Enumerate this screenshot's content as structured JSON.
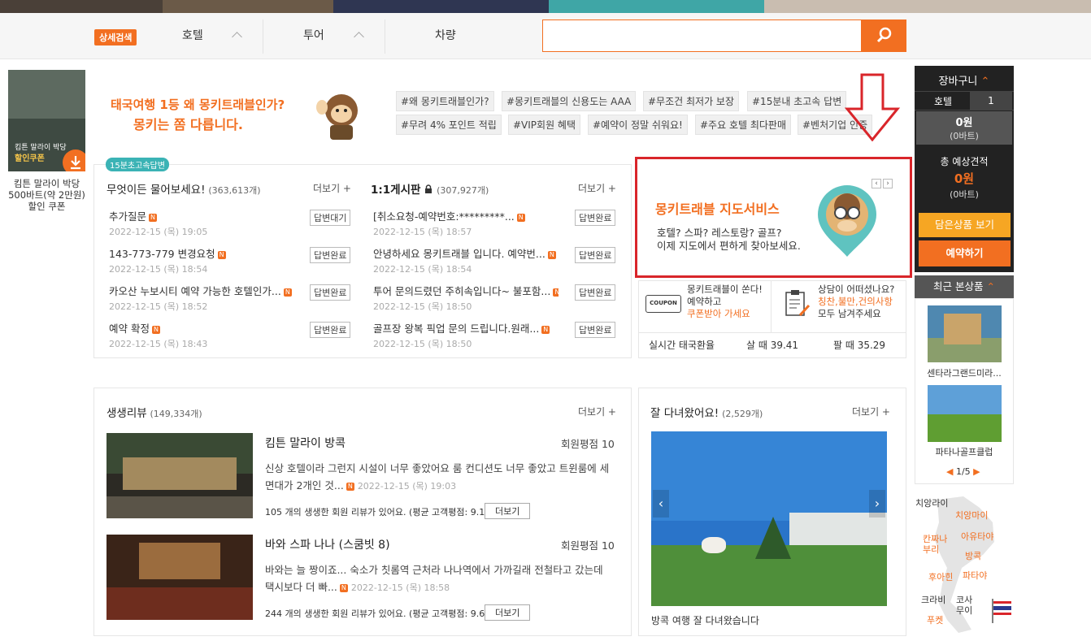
{
  "nav": {
    "badge": "상세검색",
    "tabs": [
      "호텔",
      "투어",
      "차량"
    ],
    "search_placeholder": ""
  },
  "promo": {
    "thumb_line1": "킴튼 말라이 박당",
    "thumb_line2": "할인쿠폰",
    "caption1": "킴튼 말라이 박당",
    "caption2": "500바트(약 2만원)",
    "caption3": "할인 쿠폰",
    "headline1": "태국여행 1등 왜 몽키트래블인가?",
    "headline2": "몽키는 쫌 다릅니다.",
    "tags": [
      "#왜 몽키트래블인가?",
      "#몽키트래블의 신용도는 AAA",
      "#무조건 최저가 보장",
      "#15분내 초고속 답변",
      "#무려 4% 포인트 적립",
      "#VIP회원 혜택",
      "#예약이 정말 쉬워요!",
      "#주요 호텔 최다판매",
      "#벤처기업 인증"
    ]
  },
  "qa": {
    "fast_badge": "15분초고속답변",
    "left_title": "무엇이든 물어보세요!",
    "left_count": "(363,613개)",
    "right_title": "1:1게시판",
    "right_count": "(307,927개)",
    "more": "더보기 +",
    "left_items": [
      {
        "q": "추가질문",
        "date": "2022-12-15 (목) 19:05",
        "status": "답변대기"
      },
      {
        "q": "143-773-779 변경요청",
        "date": "2022-12-15 (목) 18:54",
        "status": "답변완료"
      },
      {
        "q": "카오산 누보시티 예약 가능한 호텔인가...",
        "date": "2022-12-15 (목) 18:52",
        "status": "답변완료"
      },
      {
        "q": "예약 확정",
        "date": "2022-12-15 (목) 18:43",
        "status": "답변완료"
      }
    ],
    "right_items": [
      {
        "q": "[취소요청-예약번호:*********...",
        "date": "2022-12-15 (목) 18:57",
        "status": "답변완료"
      },
      {
        "q": "안녕하세요 몽키트래블 입니다. 예약번...",
        "date": "2022-12-15 (목) 18:54",
        "status": "답변완료"
      },
      {
        "q": "투어 문의드렸던 주히속입니다~ 불포함...",
        "date": "2022-12-15 (목) 18:50",
        "status": "답변완료"
      },
      {
        "q": "골프장 왕복 픽업 문의 드립니다.원래...",
        "date": "2022-12-15 (목) 18:50",
        "status": "답변완료"
      }
    ],
    "new_mark": "N"
  },
  "map_service": {
    "title": "몽키트래블 지도서비스",
    "line1": "호텔? 스파? 레스토랑? 골프?",
    "line2": "이제 지도에서 편하게 찾아보세요."
  },
  "coupon": {
    "icon_text": "COUPON",
    "line1": "몽키트래블이 쏜다!",
    "line2": "예약하고",
    "line3": "쿠폰받아 가세요"
  },
  "consult": {
    "line1": "상담이 어떠셨나요?",
    "line2": "칭찬,불만,건의사항",
    "line3": "모두 남겨주세요"
  },
  "rate": {
    "label": "실시간 태국환율",
    "buy": "살 때 39.41",
    "sell": "팔 때 35.29"
  },
  "reviews": {
    "title": "생생리뷰",
    "count": "(149,334개)",
    "more": "더보기 +",
    "items": [
      {
        "title": "킴튼 말라이 방콕",
        "score": "회원평점 10",
        "body1": "신상 호텔이라 그런지 시설이 너무 좋았어요 룸 컨디션도 너무 좋았고 트윈룸에 세",
        "body2": "면대가 2개인 것...",
        "date": "2022-12-15 (목) 19:03",
        "foot": "105 개의 생생한 회원 리뷰가 있어요. (평균 고객평점: 9.1)",
        "btn": "더보기"
      },
      {
        "title": "바와 스파 나나 (스쿰빗 8)",
        "score": "회원평점 10",
        "body1": "바와는 늘 짱이죠... 숙소가 칫롬역 근처라 나나역에서 가까길래 전철타고 갔는데",
        "body2": "택시보다 더 빠...",
        "date": "2022-12-15 (목) 18:58",
        "foot": "244 개의 생생한 회원 리뷰가 있어요. (평균 고객평점: 9.6)",
        "btn": "더보기"
      }
    ]
  },
  "visited": {
    "title": "잘 다녀왔어요!",
    "count": "(2,529개)",
    "more": "더보기 +",
    "caption": "방콕 여행 잘 다녀왔습니다"
  },
  "cart": {
    "title": "장바구니",
    "hotel_label": "호텔",
    "hotel_count": "1",
    "amount": "0원",
    "amount_baht": "(0바트)",
    "total_label": "총 예상견적",
    "total": "0원",
    "total_baht": "(0바트)",
    "view_btn": "담은상품 보기",
    "book_btn": "예약하기"
  },
  "recent": {
    "title": "최근 본상품",
    "items": [
      "센타라그랜드미라...",
      "파타나골프클럽"
    ],
    "pager": "1/5"
  },
  "thai_map": {
    "labels": [
      "치앙라이",
      "치앙마이",
      "아유타야",
      "칸짜나\n부리",
      "방콕",
      "후아힌",
      "파타야",
      "크라비",
      "코사\n무이",
      "푸켓"
    ]
  },
  "colors": {
    "accent": "#f26f21",
    "highlight_box": "#d9252a",
    "dark": "#222222"
  }
}
